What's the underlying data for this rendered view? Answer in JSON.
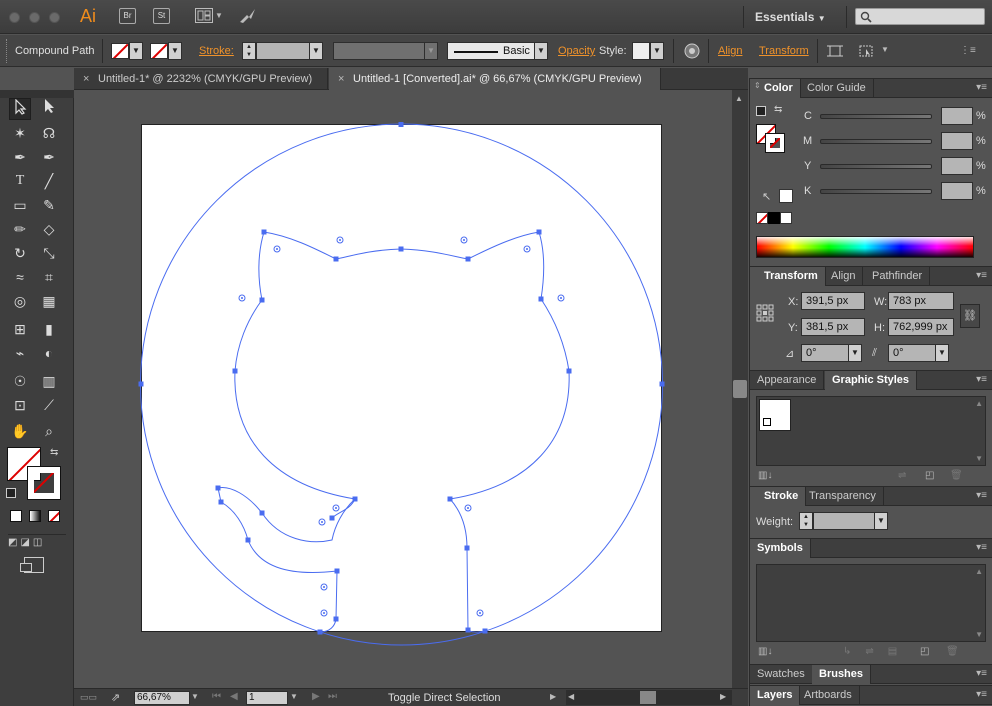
{
  "titlebar": {
    "app_logo": "Ai",
    "bridge_button": "Br",
    "stock_button": "St",
    "workspace": "Essentials",
    "search_placeholder": ""
  },
  "controlbar": {
    "selection_type": "Compound Path",
    "stroke_label": "Stroke:",
    "brush_style": "Basic",
    "opacity_label": "Opacity",
    "style_label": "Style:",
    "align_label": "Align",
    "transform_label": "Transform"
  },
  "tabs": [
    {
      "label": "Untitled-1* @ 2232% (CMYK/GPU Preview)",
      "active": false
    },
    {
      "label": "Untitled-1 [Converted].ai* @ 66,67% (CMYK/GPU Preview)",
      "active": true
    }
  ],
  "status": {
    "zoom": "66,67%",
    "artboard_number": "1",
    "tool_status": "Toggle Direct Selection"
  },
  "panels": {
    "color": {
      "tabs": [
        "Color",
        "Color Guide"
      ],
      "channels": [
        {
          "label": "C",
          "unit": "%"
        },
        {
          "label": "M",
          "unit": "%"
        },
        {
          "label": "Y",
          "unit": "%"
        },
        {
          "label": "K",
          "unit": "%"
        }
      ]
    },
    "transform": {
      "tabs": [
        "Transform",
        "Align",
        "Pathfinder"
      ],
      "x_label": "X:",
      "x_value": "391,5 px",
      "y_label": "Y:",
      "y_value": "381,5 px",
      "w_label": "W:",
      "w_value": "783 px",
      "h_label": "H:",
      "h_value": "762,999 px",
      "angle_value": "0°",
      "shear_value": "0°"
    },
    "appearance": {
      "tabs": [
        "Appearance",
        "Graphic Styles"
      ]
    },
    "stroke": {
      "tabs": [
        "Stroke",
        "Transparency"
      ],
      "weight_label": "Weight:"
    },
    "symbols": {
      "tabs": [
        "Symbols"
      ]
    },
    "brushes": {
      "tabs": [
        "Swatches",
        "Brushes"
      ]
    },
    "layers": {
      "tabs": [
        "Layers",
        "Artboards"
      ]
    }
  },
  "colors": {
    "accent_orange": "#f0922a",
    "path_blue": "#4a6cf0",
    "ui_dark": "#3e3e3e",
    "ui_mid": "#535353"
  }
}
